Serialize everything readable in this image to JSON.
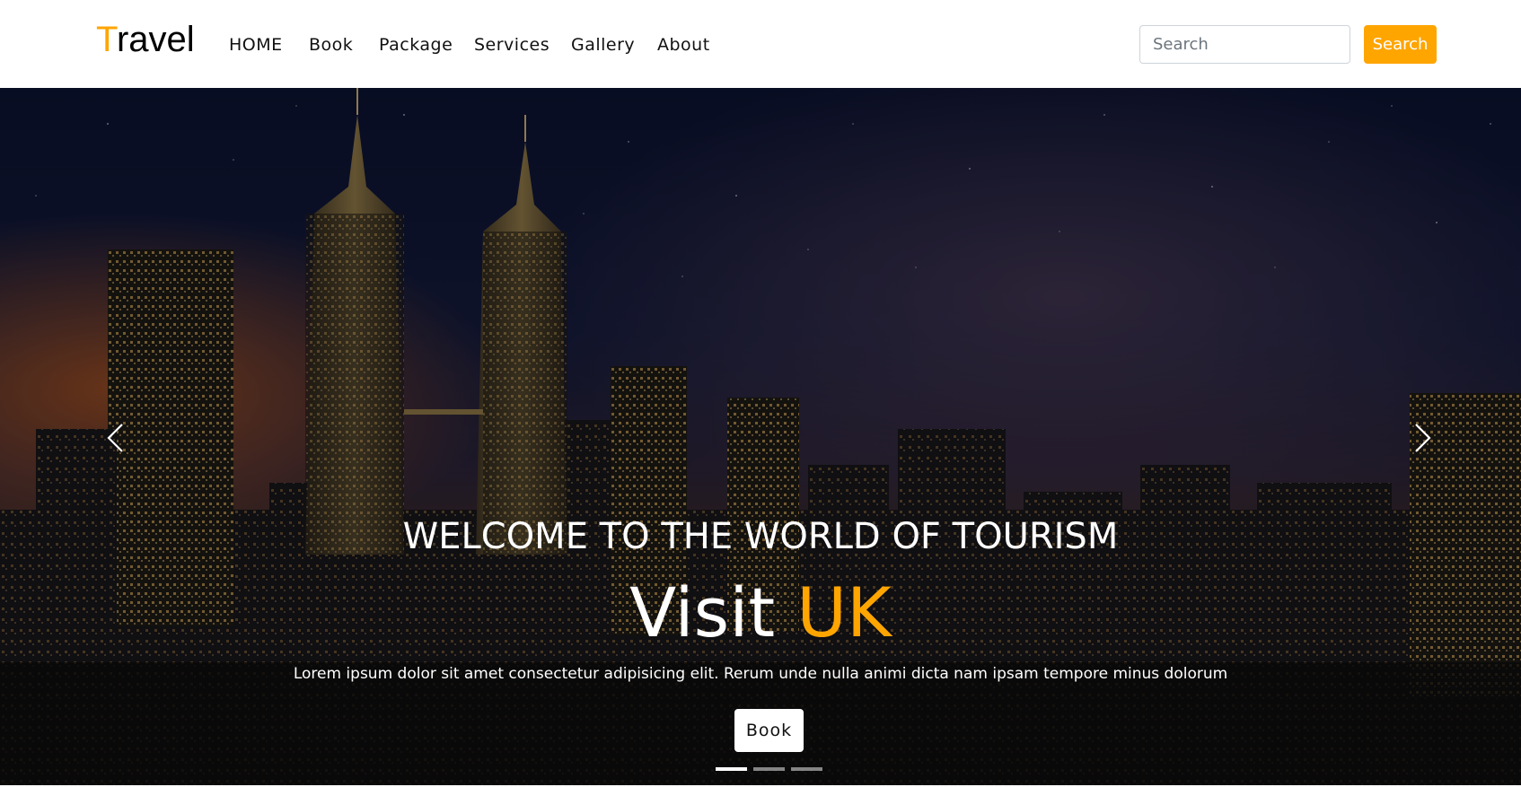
{
  "brand": {
    "first_letter": "T",
    "rest": "ravel",
    "accent_color": "#ffa500"
  },
  "nav": {
    "items": [
      {
        "label": "HOME"
      },
      {
        "label": "Book"
      },
      {
        "label": "Package"
      },
      {
        "label": "Services"
      },
      {
        "label": "Gallery"
      },
      {
        "label": "About"
      }
    ]
  },
  "search": {
    "placeholder": "Search",
    "value": "",
    "button_label": "Search",
    "button_color": "#ffa500"
  },
  "hero": {
    "heading": "WELCOME TO THE WORLD OF TOURISM",
    "title_prefix": "Visit",
    "title_highlight": "UK",
    "text": "Lorem ipsum dolor sit amet consectetur adipisicing elit. Rerum unde nulla animi dicta nam ipsam tempore minus dolorum",
    "button_label": "Book",
    "prev_icon": "chevron-left-icon",
    "next_icon": "chevron-right-icon",
    "slides_count": 3,
    "active_slide": 1
  }
}
